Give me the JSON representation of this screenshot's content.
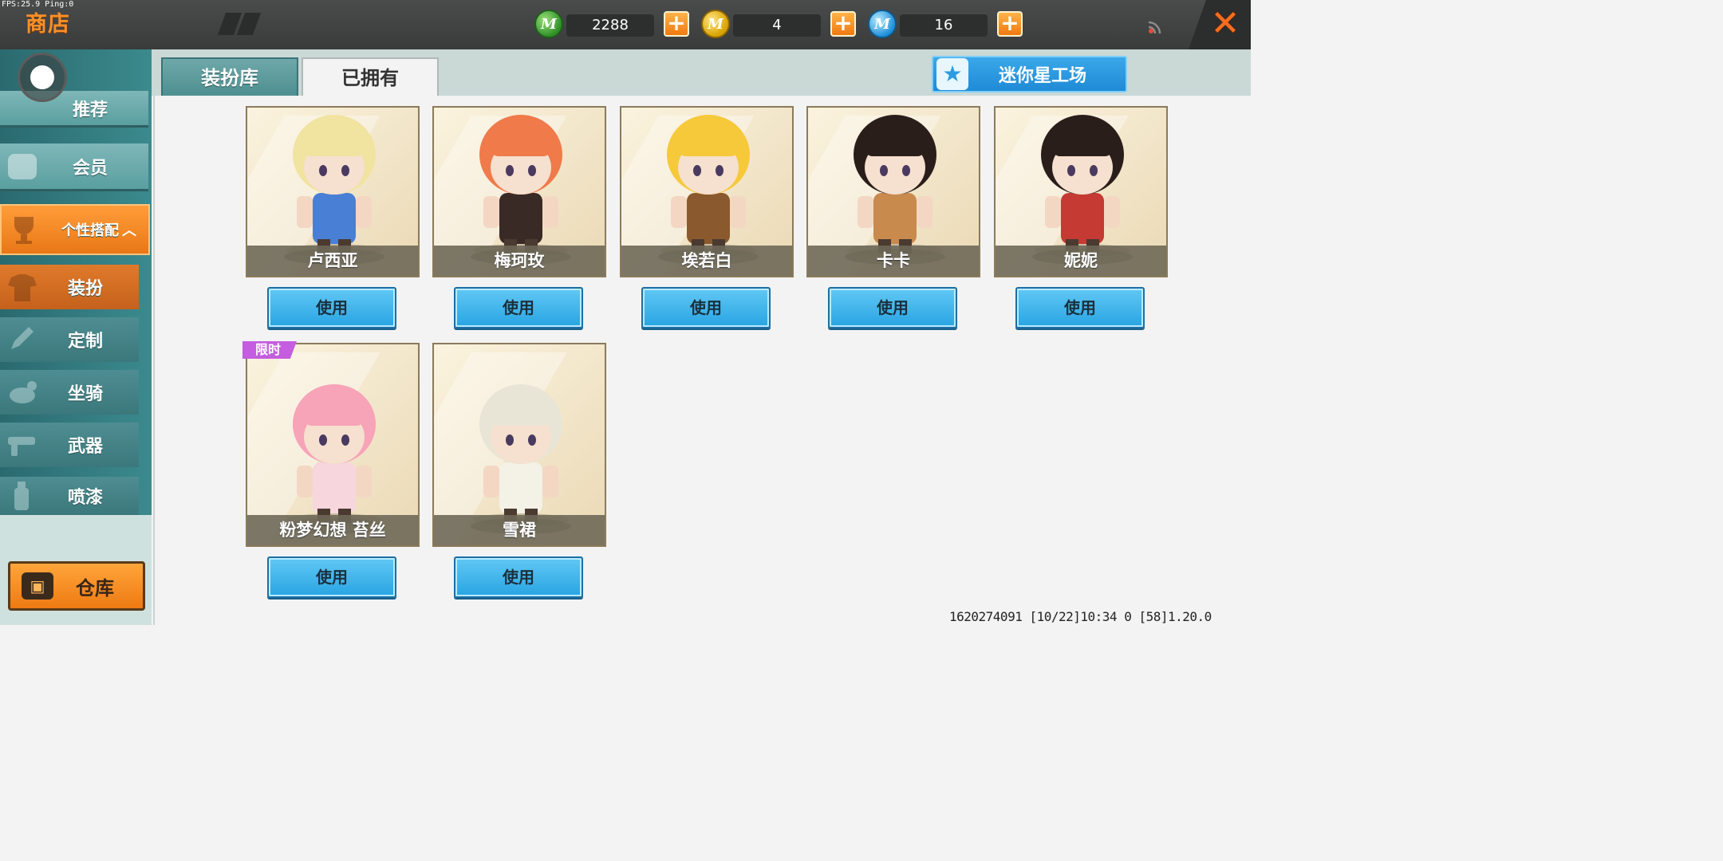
{
  "debug": {
    "fps": "FPS:25.9  Ping:0"
  },
  "header": {
    "title": "商店",
    "close_icon": "close-icon"
  },
  "currencies": [
    {
      "name": "mini-bean",
      "value": "2288",
      "color": "#3aa033",
      "glyph": "M"
    },
    {
      "name": "mini-coin",
      "value": "4",
      "color": "#e0b000",
      "glyph": "M"
    },
    {
      "name": "mini-point",
      "value": "16",
      "color": "#2a98e0",
      "glyph": "M"
    }
  ],
  "sidebar": {
    "items": [
      {
        "label": "推荐",
        "icon": "thumb-icon"
      },
      {
        "label": "会员",
        "icon": "vip-icon"
      },
      {
        "label": "个性搭配",
        "icon": "trophy-icon",
        "expanded": true,
        "caret": "︿"
      },
      {
        "label": "装扮",
        "icon": "shirt-icon",
        "selected": true
      },
      {
        "label": "定制",
        "icon": "pencil-icon"
      },
      {
        "label": "坐骑",
        "icon": "mount-icon"
      },
      {
        "label": "武器",
        "icon": "gun-icon"
      },
      {
        "label": "喷漆",
        "icon": "spray-icon"
      }
    ],
    "warehouse_label": "仓库"
  },
  "tabs": [
    {
      "label": "装扮库",
      "active": false
    },
    {
      "label": "已拥有",
      "active": true
    }
  ],
  "workshop_label": "迷你星工场",
  "use_label": "使用",
  "outfits": [
    {
      "name": "卢西亚",
      "hair": "#f1e3a0",
      "outfit": "#4a7fd6"
    },
    {
      "name": "梅珂玫",
      "hair": "#f07a4a",
      "outfit": "#3a2a26"
    },
    {
      "name": "埃若白",
      "hair": "#f6c93a",
      "outfit": "#8a5a2e"
    },
    {
      "name": "卡卡",
      "hair": "#2a1e1a",
      "outfit": "#c98a4e"
    },
    {
      "name": "妮妮",
      "hair": "#2a1e1a",
      "outfit": "#c63a34"
    },
    {
      "name": "粉梦幻想 苔丝",
      "hair": "#f7a3b8",
      "outfit": "#f8d6de",
      "badge": "限时"
    },
    {
      "name": "雪裙",
      "hair": "#e9e5d6",
      "outfit": "#f4f1e6"
    }
  ],
  "footer": {
    "info": "1620274091   [10/22]10:34 0  [58]1.20.0"
  }
}
